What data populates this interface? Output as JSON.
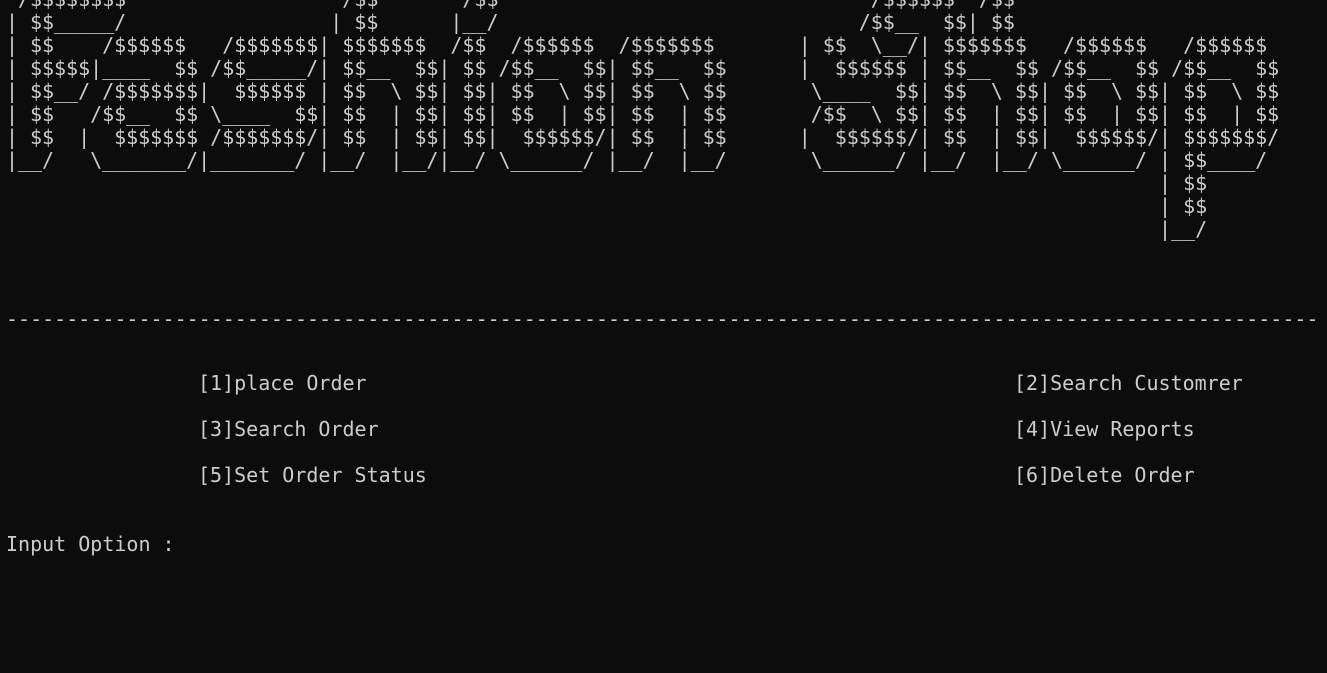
{
  "terminal": {
    "banner_ascii": " /$$$$$$$$                  /$$       /$$                               /$$$$$$  /$$\n| $$_____/                 | $$      |__/                              /$$__  $$| $$\n| $$    /$$$$$$   /$$$$$$$| $$$$$$$  /$$  /$$$$$$  /$$$$$$$       | $$  \\__/| $$$$$$$   /$$$$$$   /$$$$$$\n| $$$$$|____  $$ /$$_____/| $$__  $$| $$ /$$__  $$| $$__  $$      |  $$$$$$ | $$__  $$ /$$__  $$ /$$__  $$\n| $$__/ /$$$$$$$|  $$$$$$ | $$  \\ $$| $$| $$  \\ $$| $$  \\ $$       \\____  $$| $$  \\ $$| $$  \\ $$| $$  \\ $$\n| $$   /$$__  $$ \\____  $$| $$  | $$| $$| $$  | $$| $$  | $$       /$$  \\ $$| $$  | $$| $$  | $$| $$  | $$\n| $$  |  $$$$$$$ /$$$$$$$/| $$  | $$| $$|  $$$$$$/| $$  | $$      |  $$$$$$/| $$  | $$|  $$$$$$/| $$$$$$$/\n|__/   \\_______/|_______/ |__/  |__/|__/ \\______/ |__/  |__/       \\______/ |__/  |__/ \\______/ | $$____/\n                                                                                                | $$\n                                                                                                | $$\n                                                                                                |__/",
    "divider": "-------------------------------------------------------------------------------------------------------------",
    "menu": {
      "opt1": "[1]place Order",
      "opt2": "[2]Search Customrer",
      "opt3": "[3]Search Order",
      "opt4": "[4]View Reports",
      "opt5": "[5]Set Order Status",
      "opt6": "[6]Delete Order"
    },
    "prompt": "Input Option :"
  }
}
